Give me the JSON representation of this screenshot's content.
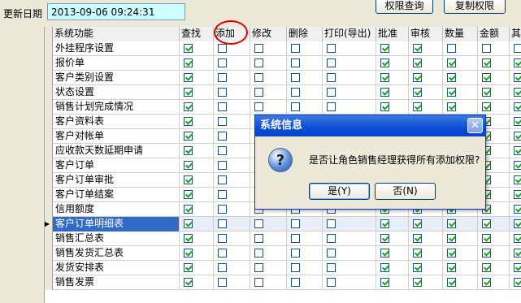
{
  "header": {
    "update_date_label": "更新日期",
    "update_date_value": "2013-09-06 09:24:31"
  },
  "toolbar": {
    "query_permission": "权限查询",
    "copy_permission": "复制权限"
  },
  "grid": {
    "columns": [
      "系统功能",
      "查找",
      "添加",
      "修改",
      "删除",
      "打印(导出)",
      "批准",
      "审核",
      "数量",
      "金额",
      "其"
    ],
    "rows": [
      {
        "name": "外挂程序设置",
        "checks": [
          true,
          false,
          false,
          false,
          false,
          true,
          true,
          false,
          false,
          false
        ]
      },
      {
        "name": "报价单",
        "checks": [
          true,
          false,
          false,
          false,
          false,
          true,
          true,
          true,
          true,
          true
        ]
      },
      {
        "name": "客户类别设置",
        "checks": [
          true,
          false,
          false,
          false,
          false,
          true,
          true,
          true,
          true,
          true
        ]
      },
      {
        "name": "状态设置",
        "checks": [
          true,
          false,
          false,
          false,
          false,
          true,
          true,
          true,
          true,
          true
        ]
      },
      {
        "name": "销售计划完成情况",
        "checks": [
          true,
          false,
          false,
          false,
          false,
          true,
          true,
          true,
          true,
          true
        ]
      },
      {
        "name": "客户资料表",
        "checks": [
          true,
          false,
          false,
          false,
          false,
          true,
          true,
          true,
          true,
          true
        ]
      },
      {
        "name": "客户对帐单",
        "checks": [
          true,
          false,
          false,
          false,
          false,
          true,
          true,
          true,
          true,
          true
        ]
      },
      {
        "name": "应收款天数延期申请",
        "checks": [
          true,
          false,
          false,
          false,
          false,
          true,
          true,
          true,
          true,
          true
        ]
      },
      {
        "name": "客户订单",
        "checks": [
          true,
          false,
          false,
          false,
          false,
          true,
          true,
          true,
          true,
          true
        ]
      },
      {
        "name": "客户订单审批",
        "checks": [
          true,
          false,
          false,
          false,
          false,
          true,
          true,
          true,
          true,
          true
        ]
      },
      {
        "name": "客户订单结案",
        "checks": [
          true,
          false,
          false,
          false,
          false,
          true,
          true,
          true,
          true,
          true
        ]
      },
      {
        "name": "信用额度",
        "checks": [
          true,
          false,
          false,
          false,
          false,
          true,
          true,
          true,
          true,
          true
        ]
      },
      {
        "name": "客户订单明细表",
        "checks": [
          true,
          false,
          false,
          false,
          false,
          true,
          true,
          true,
          true,
          true
        ],
        "selected": true
      },
      {
        "name": "销售汇总表",
        "checks": [
          true,
          false,
          false,
          false,
          false,
          true,
          true,
          true,
          true,
          true
        ]
      },
      {
        "name": "销售发货汇总表",
        "checks": [
          true,
          false,
          false,
          false,
          false,
          true,
          true,
          true,
          true,
          true
        ]
      },
      {
        "name": "发货安排表",
        "checks": [
          true,
          false,
          false,
          false,
          false,
          true,
          true,
          true,
          true,
          true
        ]
      },
      {
        "name": "销售发票",
        "checks": [
          true,
          false,
          false,
          false,
          false,
          true,
          true,
          true,
          true,
          true
        ]
      }
    ]
  },
  "dialog": {
    "title": "系统信息",
    "message": "是否让角色销售经理获得所有添加权限?",
    "yes_label": "是(Y)",
    "no_label": "否(N)"
  },
  "icons": {
    "question": "question-icon",
    "close": "close-icon"
  },
  "colors": {
    "date_bg": "#ccffff",
    "title_bar": "#0a4bd6",
    "selection": "#316ac5",
    "annotation": "#e00000",
    "check": "#21a121"
  }
}
